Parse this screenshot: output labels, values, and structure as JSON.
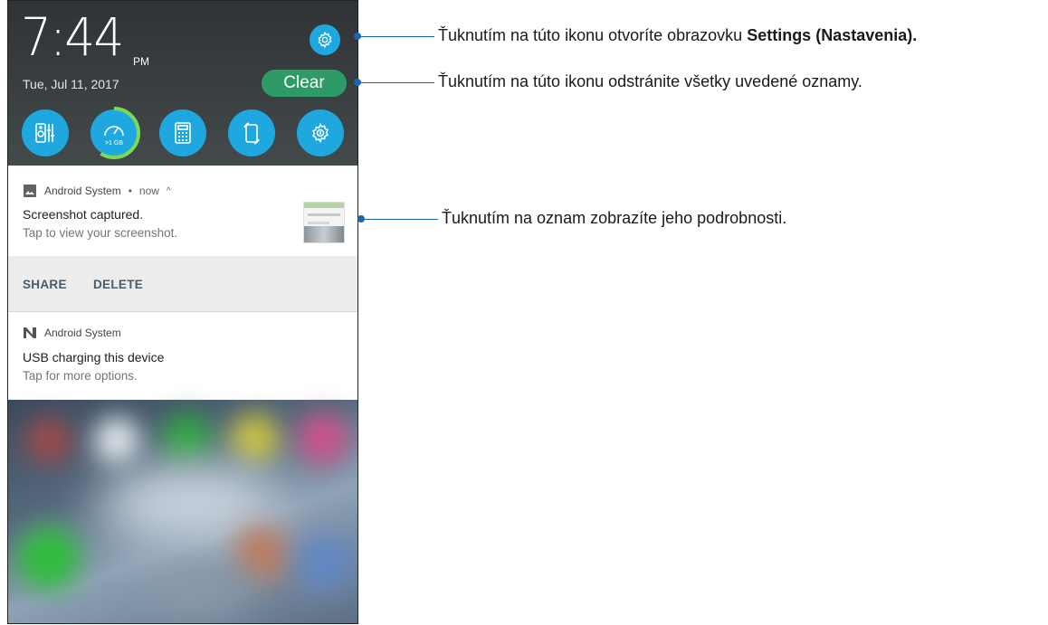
{
  "status": {
    "time": "7:44",
    "ampm": "PM",
    "date": "Tue, Jul 11, 2017",
    "clear_label": "Clear"
  },
  "quick_settings": [
    {
      "name": "audio-wizard",
      "icon": "equalizer-icon"
    },
    {
      "name": "boost",
      "icon": "speedometer-icon",
      "badge": ">1 GB"
    },
    {
      "name": "calculator",
      "icon": "calculator-icon"
    },
    {
      "name": "auto-rotate",
      "icon": "rotate-icon"
    },
    {
      "name": "settings",
      "icon": "gear-icon"
    }
  ],
  "notifications": [
    {
      "app": "Android System",
      "time": "now",
      "title": "Screenshot captured.",
      "text": "Tap to view your screenshot.",
      "actions": [
        "SHARE",
        "DELETE"
      ]
    },
    {
      "app": "Android System",
      "title": "USB charging this device",
      "text": "Tap for more options."
    }
  ],
  "annotations": {
    "settings": {
      "text": "Ťuknutím na túto ikonu otvoríte obrazovku ",
      "bold": "Settings (Nastavenia)."
    },
    "clear": "Ťuknutím na túto ikonu odstránite všetky uvedené oznamy.",
    "notification": "Ťuknutím na oznam zobrazíte jeho podrobnosti."
  },
  "colors": {
    "quick_settings": "#1fa8e0",
    "clear": "#2e9b66",
    "callout": "#1b66b0",
    "boost_ring": "#7ed957"
  }
}
